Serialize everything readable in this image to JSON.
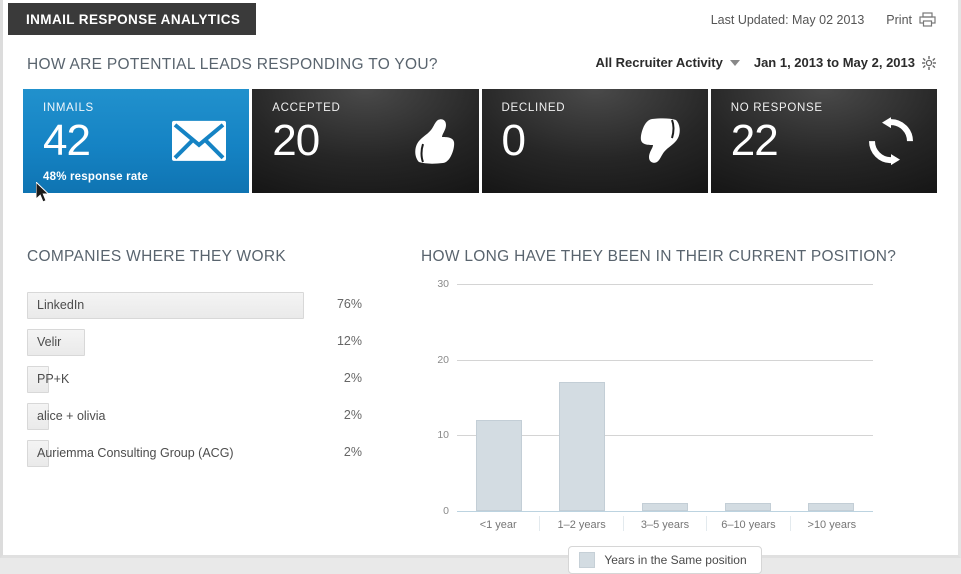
{
  "header": {
    "app_title": "INMAIL RESPONSE ANALYTICS",
    "last_updated": "Last Updated: May 02 2013",
    "print_label": "Print",
    "print_icon": "printer-icon"
  },
  "subheader": {
    "question": "HOW ARE POTENTIAL LEADS RESPONDING TO YOU?",
    "activity_filter": "All Recruiter Activity",
    "date_range": "Jan 1, 2013 to May 2, 2013",
    "caret_icon": "chevron-down-icon",
    "gear_icon": "gear-icon"
  },
  "tiles": [
    {
      "label": "INMAILS",
      "value": "42",
      "sub": "48% response rate",
      "icon": "envelope-icon",
      "theme": "blue",
      "color": "#1583c4"
    },
    {
      "label": "ACCEPTED",
      "value": "20",
      "sub": "",
      "icon": "thumbs-up-icon",
      "theme": "dark",
      "color": "#262626"
    },
    {
      "label": "DECLINED",
      "value": "0",
      "sub": "",
      "icon": "thumbs-down-icon",
      "theme": "dark",
      "color": "#262626"
    },
    {
      "label": "NO RESPONSE",
      "value": "22",
      "sub": "",
      "icon": "refresh-circle-icon",
      "theme": "dark",
      "color": "#262626"
    }
  ],
  "companies": {
    "title": "COMPANIES WHERE THEY WORK",
    "rows": [
      {
        "name": "LinkedIn",
        "pct_label": "76%",
        "pct": 76
      },
      {
        "name": "Velir",
        "pct_label": "12%",
        "pct": 12
      },
      {
        "name": "PP+K",
        "pct_label": "2%",
        "pct": 2
      },
      {
        "name": "alice + olivia",
        "pct_label": "2%",
        "pct": 2
      },
      {
        "name": "Auriemma Consulting Group (ACG)",
        "pct_label": "2%",
        "pct": 2
      }
    ]
  },
  "chart_data": {
    "type": "bar",
    "title": "HOW LONG HAVE THEY BEEN IN THEIR CURRENT POSITION?",
    "categories": [
      "<1 year",
      "1–2 years",
      "3–5 years",
      "6–10 years",
      ">10 years"
    ],
    "values": [
      12,
      17,
      1,
      1,
      1
    ],
    "series": [
      {
        "name": "Years in the Same position",
        "values": [
          12,
          17,
          1,
          1,
          1
        ]
      }
    ],
    "xlabel": "",
    "ylabel": "",
    "ylim": [
      0,
      30
    ],
    "yticks": [
      0,
      10,
      20,
      30
    ],
    "ytick_labels": [
      "0",
      "10",
      "20",
      "30"
    ],
    "grid": true,
    "legend": [
      "Years in the Same position"
    ],
    "legend_position": "bottom",
    "bar_color": "#d3dce2"
  }
}
